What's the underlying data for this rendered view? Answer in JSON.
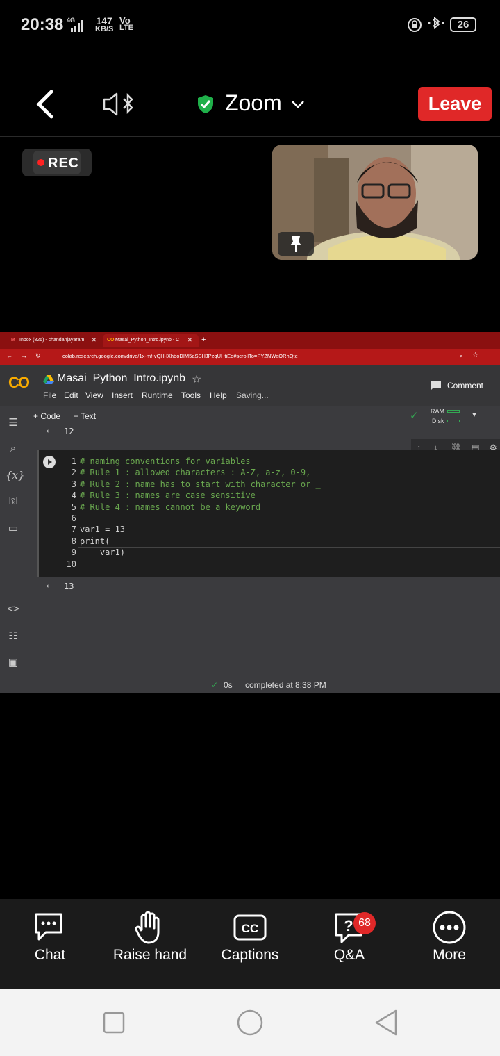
{
  "status_bar": {
    "time": "20:38",
    "network": "4G",
    "speed_value": "147",
    "speed_unit": "KB/S",
    "volte_top": "Vo",
    "volte_bottom": "LTE",
    "battery": "26"
  },
  "zoom": {
    "title": "Zoom",
    "leave_label": "Leave",
    "rec_label": "REC"
  },
  "browser": {
    "tab1": "Inbox (826) - chandanjayaram",
    "tab2": "Masai_Python_Intro.ipynb - C",
    "url": "colab.research.google.com/drive/1x-mf-vQH-lXhboDIM5aSSHJPzqUHtiEo#scrollTo=PYZNWaORhQte"
  },
  "colab": {
    "logo": "CO",
    "notebook_title": "Masai_Python_Intro.ipynb",
    "menu": [
      "File",
      "Edit",
      "View",
      "Insert",
      "Runtime",
      "Tools",
      "Help"
    ],
    "saving": "Saving...",
    "comment_label": "Comment",
    "code_btn": "+ Code",
    "text_btn": "+ Text",
    "ram": "RAM",
    "disk": "Disk",
    "prev_output": "12",
    "code_lines": [
      {
        "n": "1",
        "text": "# naming conventions for variables",
        "kind": "comment"
      },
      {
        "n": "2",
        "text": "# Rule 1 : allowed characters : A-Z, a-z, 0-9, _",
        "kind": "comment"
      },
      {
        "n": "3",
        "text": "# Rule 2 : name has to start with character or _",
        "kind": "comment"
      },
      {
        "n": "4",
        "text": "# Rule 3 : names are case sensitive",
        "kind": "comment"
      },
      {
        "n": "5",
        "text": "# Rule 4 : names cannot be a keyword",
        "kind": "comment"
      },
      {
        "n": "6",
        "text": "",
        "kind": "code"
      },
      {
        "n": "7",
        "text": "var1 = 13",
        "kind": "code"
      },
      {
        "n": "8",
        "text": "print(",
        "kind": "code"
      },
      {
        "n": "9",
        "text": "    var1)",
        "kind": "code"
      },
      {
        "n": "10",
        "text": "",
        "kind": "code"
      }
    ],
    "output": "13",
    "exec_time": "0s",
    "completed": "completed at 8:38 PM"
  },
  "bottom_bar": {
    "chat": "Chat",
    "raise_hand": "Raise hand",
    "captions": "Captions",
    "qa": "Q&A",
    "qa_badge": "68",
    "more": "More"
  }
}
